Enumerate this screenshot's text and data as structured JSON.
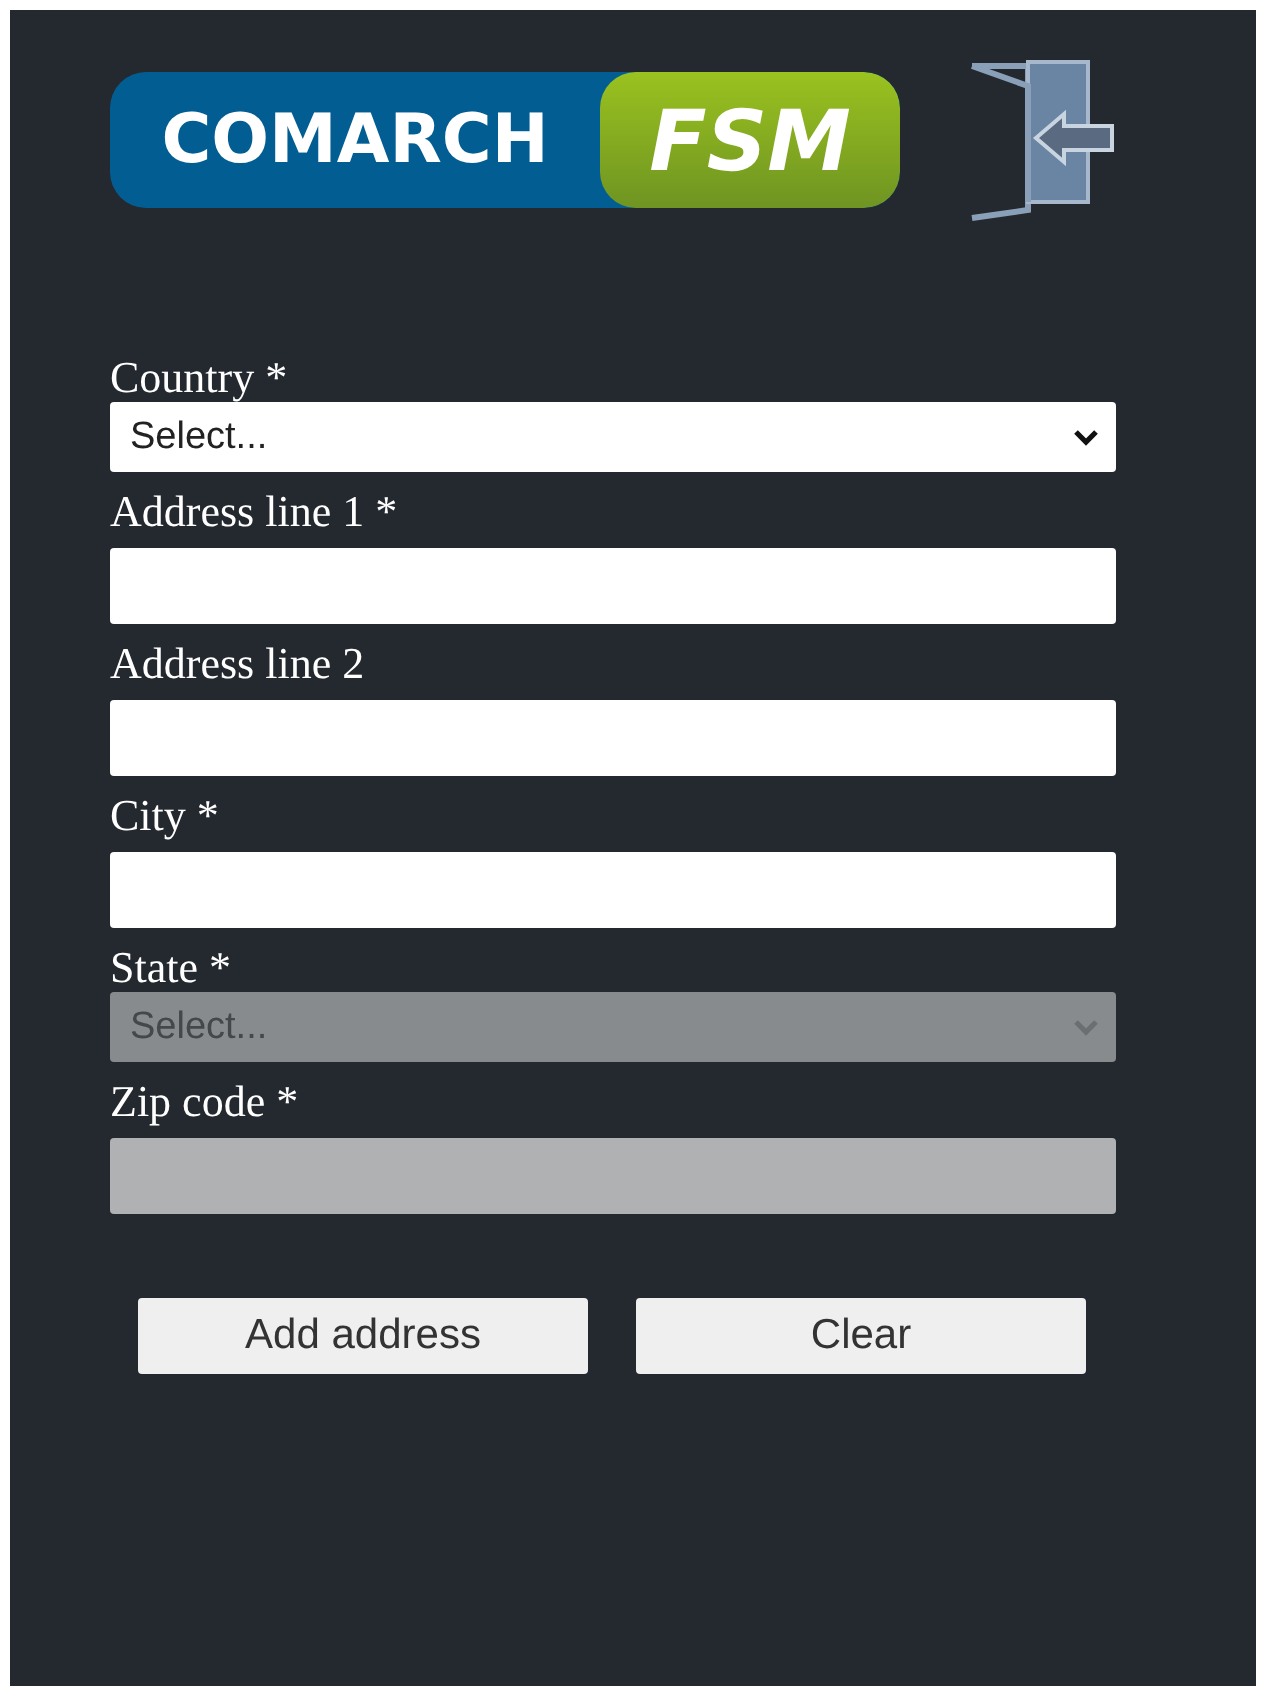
{
  "header": {
    "logo": {
      "part_1": "COMARCH",
      "part_2": "FSM"
    }
  },
  "fields": [
    {
      "label": "Country *",
      "kind": "select",
      "placeholder": "Select...",
      "disabled": false
    },
    {
      "label": "Address line 1 *",
      "kind": "text",
      "disabled": false
    },
    {
      "label": "Address line 2",
      "kind": "text",
      "disabled": false
    },
    {
      "label": "City *",
      "kind": "text",
      "disabled": false
    },
    {
      "label": "State *",
      "kind": "select",
      "placeholder": "Select...",
      "disabled": true
    },
    {
      "label": "Zip code *",
      "kind": "text",
      "disabled": true
    }
  ],
  "buttons": [
    "Add address",
    "Clear"
  ]
}
